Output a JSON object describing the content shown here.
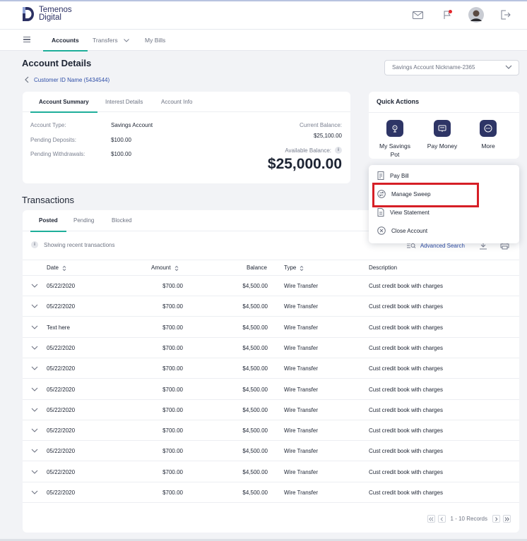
{
  "brand": {
    "line1": "Temenos",
    "line2": "Digital"
  },
  "nav": {
    "tabs": [
      "Accounts",
      "Transfers",
      "My Bills"
    ]
  },
  "page": {
    "title": "Account Details",
    "breadcrumb": "Customer ID Name (5434544)"
  },
  "account_select": {
    "value": "Savings Account Nickname-2365"
  },
  "summary": {
    "tabs": [
      "Account Summary",
      "Interest Details",
      "Account Info"
    ],
    "rows": [
      {
        "label": "Account Type:",
        "value": "Savings Account"
      },
      {
        "label": "Pending Deposits:",
        "value": "$100.00"
      },
      {
        "label": "Pending Withdrawals:",
        "value": "$100.00"
      }
    ],
    "current_balance_label": "Current Balance:",
    "current_balance": "$25,100.00",
    "available_balance_label": "Available Balance:",
    "available_balance": "$25,000.00"
  },
  "quick_actions": {
    "title": "Quick Actions",
    "items": [
      {
        "label_line1": "My Savings",
        "label_line2": "Pot",
        "icon": "piggy-bank-icon"
      },
      {
        "label_line1": "Pay Money",
        "label_line2": "",
        "icon": "pay-money-icon"
      },
      {
        "label_line1": "More",
        "label_line2": "",
        "icon": "more-icon"
      }
    ]
  },
  "more_menu": {
    "items": [
      "Pay Bill",
      "Manage Sweep",
      "View Statement",
      "Close Account"
    ]
  },
  "transactions": {
    "title": "Transactions",
    "tabs": [
      "Posted",
      "Pending",
      "Blocked"
    ],
    "info": "Showing recent transactions",
    "advanced_search": "Advanced Search",
    "columns": [
      "Date",
      "Amount",
      "Balance",
      "Type",
      "Description"
    ],
    "rows": [
      {
        "date": "05/22/2020",
        "amount": "$700.00",
        "balance": "$4,500.00",
        "type": "Wire Transfer",
        "description": "Cust credit book with charges"
      },
      {
        "date": "05/22/2020",
        "amount": "$700.00",
        "balance": "$4,500.00",
        "type": "Wire Transfer",
        "description": "Cust credit book with charges"
      },
      {
        "date": "Text here",
        "amount": "$700.00",
        "balance": "$4,500.00",
        "type": "Wire Transfer",
        "description": "Cust credit book with charges"
      },
      {
        "date": "05/22/2020",
        "amount": "$700.00",
        "balance": "$4,500.00",
        "type": "Wire Transfer",
        "description": "Cust credit book with charges"
      },
      {
        "date": "05/22/2020",
        "amount": "$700.00",
        "balance": "$4,500.00",
        "type": "Wire Transfer",
        "description": "Cust credit book with charges"
      },
      {
        "date": "05/22/2020",
        "amount": "$700.00",
        "balance": "$4,500.00",
        "type": "Wire Transfer",
        "description": "Cust credit book with charges"
      },
      {
        "date": "05/22/2020",
        "amount": "$700.00",
        "balance": "$4,500.00",
        "type": "Wire Transfer",
        "description": "Cust credit book with charges"
      },
      {
        "date": "05/22/2020",
        "amount": "$700.00",
        "balance": "$4,500.00",
        "type": "Wire Transfer",
        "description": "Cust credit book with charges"
      },
      {
        "date": "05/22/2020",
        "amount": "$700.00",
        "balance": "$4,500.00",
        "type": "Wire Transfer",
        "description": "Cust credit book with charges"
      },
      {
        "date": "05/22/2020",
        "amount": "$700.00",
        "balance": "$4,500.00",
        "type": "Wire Transfer",
        "description": "Cust credit book with charges"
      },
      {
        "date": "05/22/2020",
        "amount": "$700.00",
        "balance": "$4,500.00",
        "type": "Wire Transfer",
        "description": "Cust credit book with charges"
      }
    ],
    "pager_text": "1 - 10 Records"
  },
  "colors": {
    "accent": "#1eae9a",
    "primary_dark": "#2e3566",
    "link": "#2f4fa8",
    "highlight": "#d61f26"
  }
}
